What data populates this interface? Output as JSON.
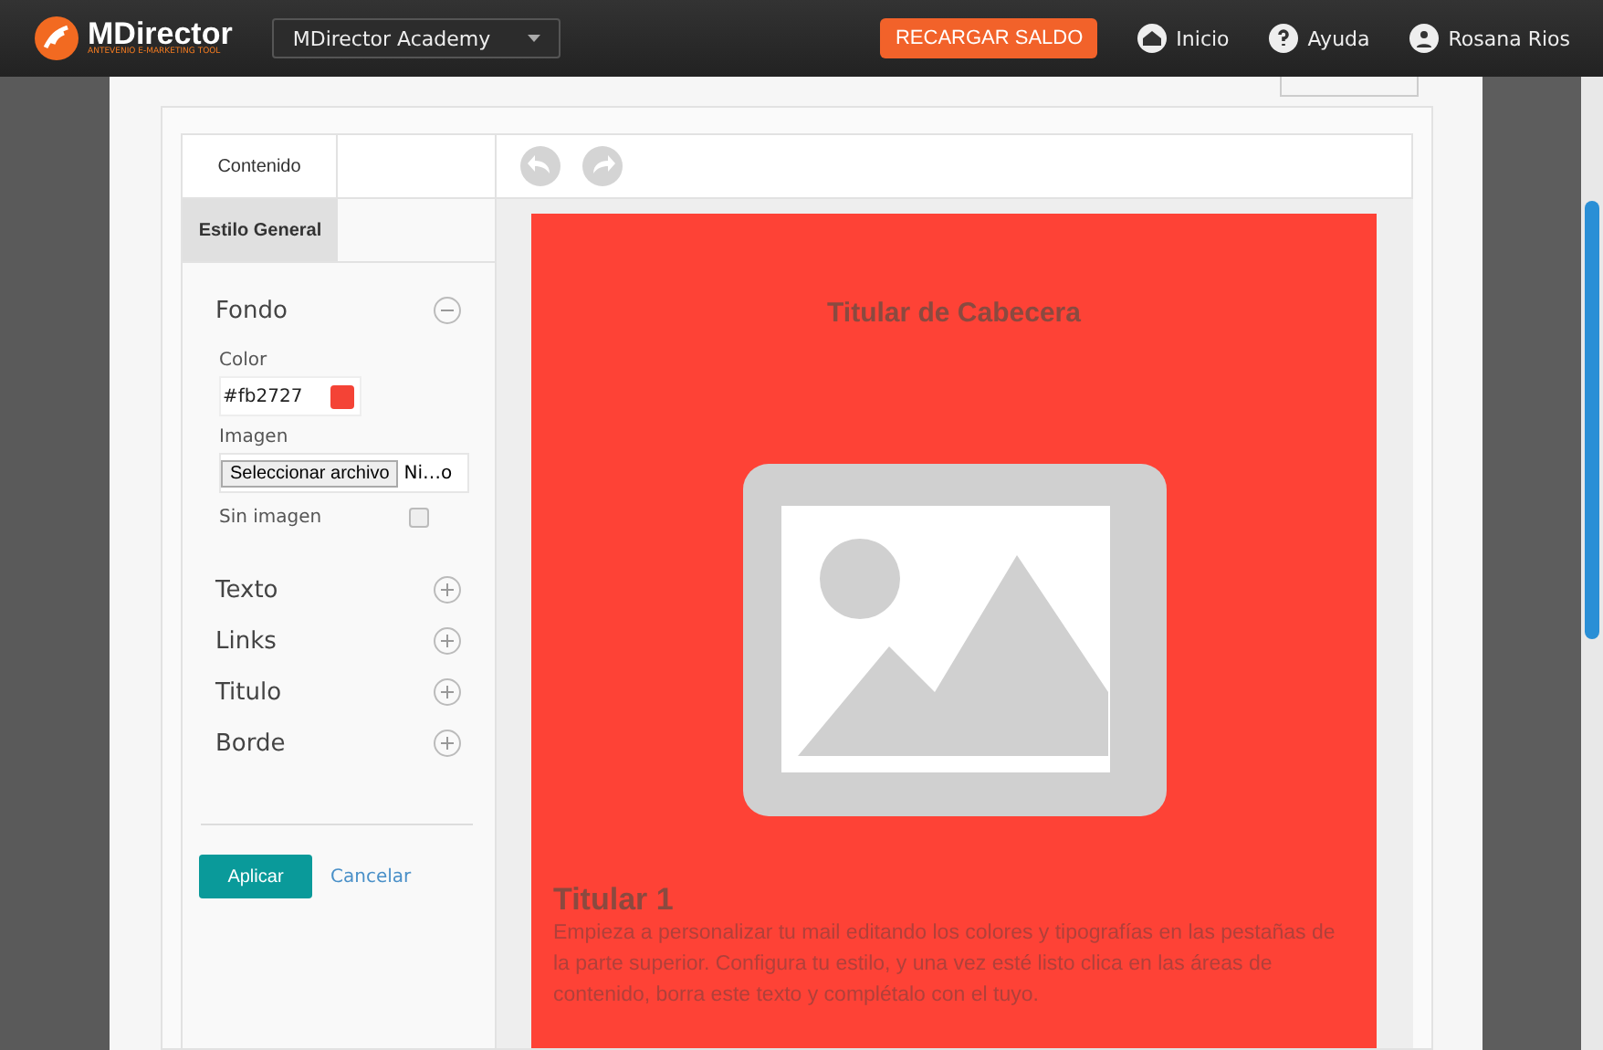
{
  "topbar": {
    "logo": "MDirector",
    "tagline": "ANTEVENIO E-MARKETING TOOL",
    "account_select": "MDirector Academy",
    "recharge_button": "RECARGAR SALDO",
    "links": [
      {
        "kind": "home",
        "label": "Inicio"
      },
      {
        "kind": "help",
        "label": "Ayuda"
      },
      {
        "kind": "user",
        "label": "Rosana Rios"
      }
    ]
  },
  "tabs": [
    {
      "label": "Contenido",
      "selected": false
    },
    {
      "label": "Estilo General",
      "selected": true
    }
  ],
  "sections": [
    {
      "title": "Fondo",
      "expanded": true
    },
    {
      "title": "Texto",
      "expanded": false
    },
    {
      "title": "Links",
      "expanded": false
    },
    {
      "title": "Titulo",
      "expanded": false
    },
    {
      "title": "Borde",
      "expanded": false
    }
  ],
  "fondo": {
    "color_label": "Color",
    "color_value": "#fb2727",
    "image_label": "Imagen",
    "file_button": "Seleccionar archivo",
    "file_name": "Ni…o",
    "no_image_label": "Sin imagen",
    "no_image_checked": false
  },
  "actions": {
    "apply": "Aplicar",
    "cancel": "Cancelar"
  },
  "email": {
    "header_title": "Titular de Cabecera",
    "heading": "Titular 1",
    "body": "Empieza a personalizar tu mail editando los colores y tipografías en las pestañas de la parte superior. Configura tu estilo, y una vez esté listo clica en las áreas de contenido, borra este texto y complétalo con el tuyo."
  }
}
